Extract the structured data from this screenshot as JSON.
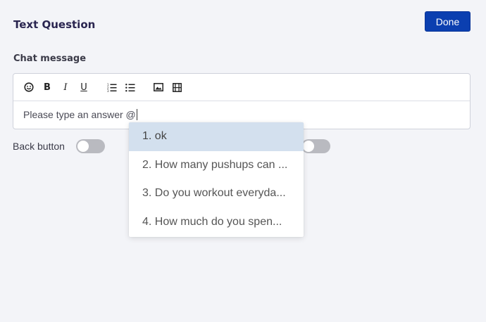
{
  "header": {
    "title": "Text Question",
    "done_label": "Done"
  },
  "editor": {
    "label": "Chat message",
    "toolbar": [
      {
        "name": "emoji-icon",
        "glyph": "☻"
      },
      {
        "name": "bold-icon",
        "glyph": "B"
      },
      {
        "name": "italic-icon",
        "glyph": "I"
      },
      {
        "name": "underline-icon",
        "glyph": "U"
      },
      {
        "name": "ordered-list-icon",
        "glyph": "≡"
      },
      {
        "name": "bullet-list-icon",
        "glyph": "☰"
      },
      {
        "name": "image-icon",
        "glyph": "▣"
      },
      {
        "name": "video-icon",
        "glyph": "▦"
      }
    ],
    "text": "Please type an answer @"
  },
  "back_button": {
    "label": "Back button",
    "enabled": false
  },
  "mention_dropdown": {
    "items": [
      {
        "label": "1. ok",
        "active": true
      },
      {
        "label": "2. How many pushups can ...",
        "active": false
      },
      {
        "label": "3. Do you workout everyda...",
        "active": false
      },
      {
        "label": "4. How much do you spen...",
        "active": false
      }
    ]
  },
  "colors": {
    "primary": "#0b3fb0",
    "active_item": "#d3e0ee",
    "toggle_off": "#b9bac0"
  }
}
